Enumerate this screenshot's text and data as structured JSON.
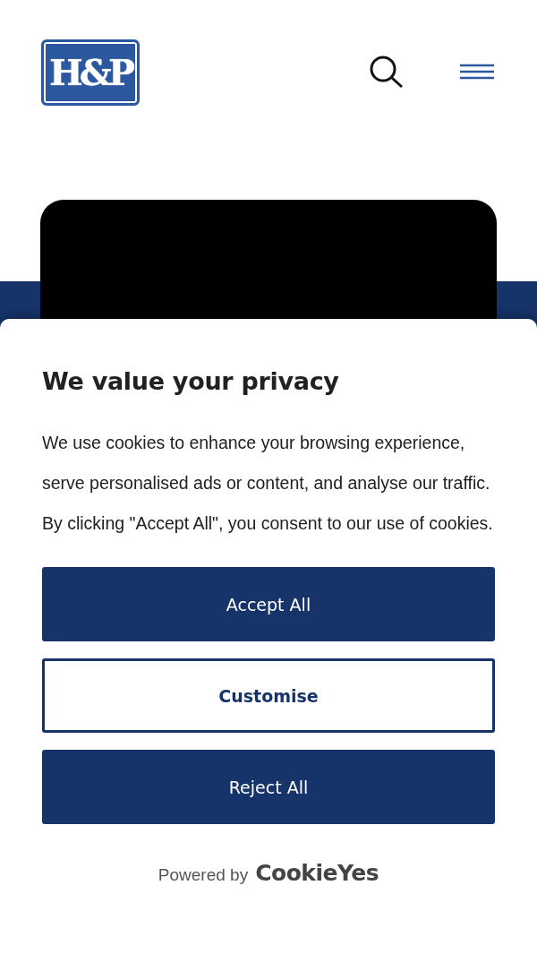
{
  "header": {
    "logo": {
      "text": "H&P"
    }
  },
  "consent": {
    "title": "We value your privacy",
    "message": "We use cookies to enhance your browsing experience, serve personalised ads or content, and analyse our traffic. By clicking \"Accept All\", you consent to our use of cookies.",
    "buttons": [
      {
        "label": "Accept All",
        "kind": "filled"
      },
      {
        "label": "Customise",
        "kind": "outline"
      },
      {
        "label": "Reject All",
        "kind": "filled"
      }
    ],
    "powered_by": {
      "text": "Powered by",
      "brand": "CookieYes"
    }
  }
}
